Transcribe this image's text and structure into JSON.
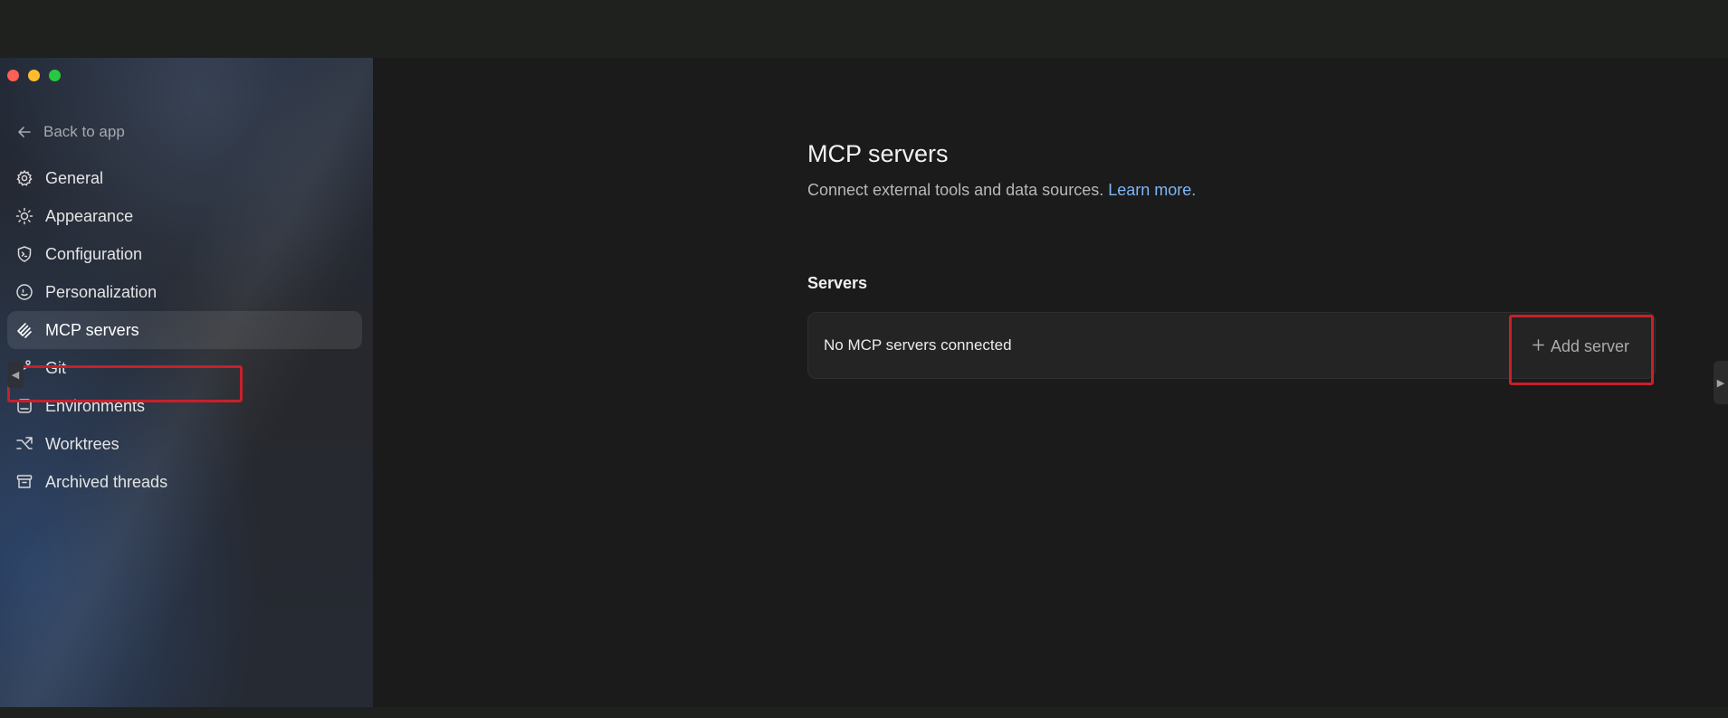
{
  "sidebar": {
    "back_label": "Back to app",
    "items": [
      {
        "label": "General",
        "icon": "gear-icon"
      },
      {
        "label": "Appearance",
        "icon": "sun-icon"
      },
      {
        "label": "Configuration",
        "icon": "terminal-shield-icon"
      },
      {
        "label": "Personalization",
        "icon": "face-icon"
      },
      {
        "label": "MCP servers",
        "icon": "mcp-icon",
        "active": true
      },
      {
        "label": "Git",
        "icon": "git-branch-icon"
      },
      {
        "label": "Environments",
        "icon": "monitor-icon"
      },
      {
        "label": "Worktrees",
        "icon": "worktree-icon"
      },
      {
        "label": "Archived threads",
        "icon": "archive-icon"
      }
    ]
  },
  "main": {
    "title": "MCP servers",
    "subtitle": "Connect external tools and data sources.",
    "learn_more": "Learn more.",
    "servers_heading": "Servers",
    "empty_state": "No MCP servers connected",
    "add_button": "Add server"
  },
  "colors": {
    "accent_link": "#7fb6f5",
    "highlight_box": "#c8202a",
    "traffic_red": "#fe5f57",
    "traffic_yellow": "#febc2e",
    "traffic_green": "#28c840"
  }
}
